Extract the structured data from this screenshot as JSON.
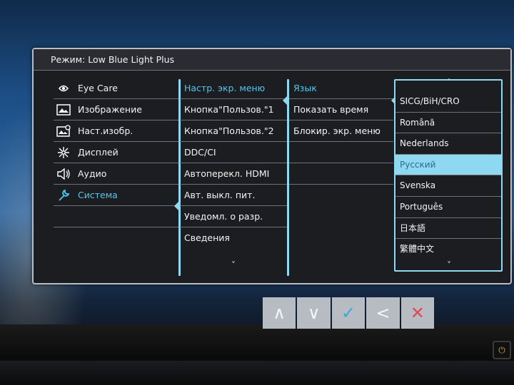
{
  "header": {
    "mode_label": "Режим:",
    "mode_value": "Low Blue Light Plus"
  },
  "main_menu": [
    {
      "label": "Eye Care",
      "icon": "eye-care-icon",
      "active": false
    },
    {
      "label": "Изображение",
      "icon": "picture-icon",
      "active": false
    },
    {
      "label": "Наст.изобр.",
      "icon": "picture-advanced-icon",
      "active": false
    },
    {
      "label": "Дисплей",
      "icon": "display-icon",
      "active": false
    },
    {
      "label": "Аудио",
      "icon": "speaker-icon",
      "active": false
    },
    {
      "label": "Система",
      "icon": "wrench-icon",
      "active": true
    }
  ],
  "system_menu": [
    {
      "label": "Настр. экр. меню",
      "active": true
    },
    {
      "label": "Кнопка\"Пользов.\"1",
      "active": false
    },
    {
      "label": "Кнопка\"Пользов.\"2",
      "active": false
    },
    {
      "label": "DDC/CI",
      "active": false
    },
    {
      "label": "Автоперекл. HDMI",
      "active": false
    },
    {
      "label": "Авт. выкл. пит.",
      "active": false
    },
    {
      "label": "Уведомл. о разр.",
      "active": false
    },
    {
      "label": "Сведения",
      "active": false
    }
  ],
  "osd_menu": [
    {
      "label": "Язык",
      "active": true
    },
    {
      "label": "Показать время",
      "active": false
    },
    {
      "label": "Блокир. экр. меню",
      "active": false
    }
  ],
  "languages": [
    {
      "label": "SICG/BiH/CRO",
      "selected": false
    },
    {
      "label": "Română",
      "selected": false
    },
    {
      "label": "Nederlands",
      "selected": false
    },
    {
      "label": "Русский",
      "selected": true
    },
    {
      "label": "Svenska",
      "selected": false
    },
    {
      "label": "Português",
      "selected": false
    },
    {
      "label": "日本語",
      "selected": false
    },
    {
      "label": "繁體中文",
      "selected": false
    }
  ],
  "scroll": {
    "up": "˄",
    "down": "˅"
  },
  "buttons": [
    {
      "name": "up-button",
      "glyph": "∧",
      "icon": "chevron-up-icon"
    },
    {
      "name": "down-button",
      "glyph": "∨",
      "icon": "chevron-down-icon"
    },
    {
      "name": "confirm-button",
      "glyph": "✓",
      "icon": "check-icon"
    },
    {
      "name": "back-button",
      "glyph": "<",
      "icon": "chevron-left-icon"
    },
    {
      "name": "exit-button",
      "glyph": "✕",
      "icon": "close-icon"
    }
  ],
  "colors": {
    "accent": "#4fc8f0",
    "highlight": "#8fd8f2",
    "panel": "#1b1d21"
  }
}
